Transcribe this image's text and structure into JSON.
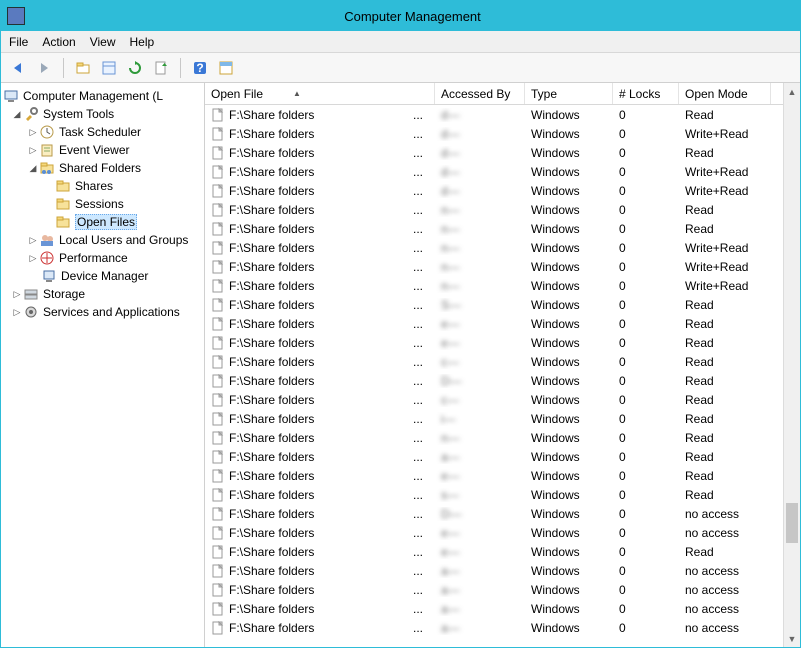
{
  "window": {
    "title": "Computer Management"
  },
  "menu": {
    "file": "File",
    "action": "Action",
    "view": "View",
    "help": "Help"
  },
  "tree": {
    "root": "Computer Management (L",
    "system_tools": "System Tools",
    "task_scheduler": "Task Scheduler",
    "event_viewer": "Event Viewer",
    "shared_folders": "Shared Folders",
    "shares": "Shares",
    "sessions": "Sessions",
    "open_files": "Open Files",
    "local_users": "Local Users and Groups",
    "performance": "Performance",
    "device_manager": "Device Manager",
    "storage": "Storage",
    "services_apps": "Services and Applications"
  },
  "columns": {
    "open_file": "Open File",
    "accessed_by": "Accessed By",
    "type": "Type",
    "locks": "# Locks",
    "open_mode": "Open Mode"
  },
  "rows": [
    {
      "file": "F:\\Share folders",
      "acc": "d—",
      "type": "Windows",
      "locks": "0",
      "mode": "Read"
    },
    {
      "file": "F:\\Share folders",
      "acc": "d—",
      "type": "Windows",
      "locks": "0",
      "mode": "Write+Read"
    },
    {
      "file": "F:\\Share folders",
      "acc": "d—",
      "type": "Windows",
      "locks": "0",
      "mode": "Read"
    },
    {
      "file": "F:\\Share folders",
      "acc": "d—",
      "type": "Windows",
      "locks": "0",
      "mode": "Write+Read"
    },
    {
      "file": "F:\\Share folders",
      "acc": "d—",
      "type": "Windows",
      "locks": "0",
      "mode": "Write+Read"
    },
    {
      "file": "F:\\Share folders",
      "acc": "n—",
      "type": "Windows",
      "locks": "0",
      "mode": "Read"
    },
    {
      "file": "F:\\Share folders",
      "acc": "n—",
      "type": "Windows",
      "locks": "0",
      "mode": "Read"
    },
    {
      "file": "F:\\Share folders",
      "acc": "n—",
      "type": "Windows",
      "locks": "0",
      "mode": "Write+Read"
    },
    {
      "file": "F:\\Share folders",
      "acc": "n—",
      "type": "Windows",
      "locks": "0",
      "mode": "Write+Read"
    },
    {
      "file": "F:\\Share folders",
      "acc": "n—",
      "type": "Windows",
      "locks": "0",
      "mode": "Write+Read"
    },
    {
      "file": "F:\\Share folders",
      "acc": "S—",
      "type": "Windows",
      "locks": "0",
      "mode": "Read"
    },
    {
      "file": "F:\\Share folders",
      "acc": "e—",
      "type": "Windows",
      "locks": "0",
      "mode": "Read"
    },
    {
      "file": "F:\\Share folders",
      "acc": "e—",
      "type": "Windows",
      "locks": "0",
      "mode": "Read"
    },
    {
      "file": "F:\\Share folders",
      "acc": "c—",
      "type": "Windows",
      "locks": "0",
      "mode": "Read"
    },
    {
      "file": "F:\\Share folders",
      "acc": "D—",
      "type": "Windows",
      "locks": "0",
      "mode": "Read"
    },
    {
      "file": "F:\\Share folders",
      "acc": "c—",
      "type": "Windows",
      "locks": "0",
      "mode": "Read"
    },
    {
      "file": "F:\\Share folders",
      "acc": "i—",
      "type": "Windows",
      "locks": "0",
      "mode": "Read"
    },
    {
      "file": "F:\\Share folders",
      "acc": "n—",
      "type": "Windows",
      "locks": "0",
      "mode": "Read"
    },
    {
      "file": "F:\\Share folders",
      "acc": "a—",
      "type": "Windows",
      "locks": "0",
      "mode": "Read"
    },
    {
      "file": "F:\\Share folders",
      "acc": "e—",
      "type": "Windows",
      "locks": "0",
      "mode": "Read"
    },
    {
      "file": "F:\\Share folders",
      "acc": "s—",
      "type": "Windows",
      "locks": "0",
      "mode": "Read"
    },
    {
      "file": "F:\\Share folders",
      "acc": "D—",
      "type": "Windows",
      "locks": "0",
      "mode": "no access"
    },
    {
      "file": "F:\\Share folders",
      "acc": "e—",
      "type": "Windows",
      "locks": "0",
      "mode": "no access"
    },
    {
      "file": "F:\\Share folders",
      "acc": "e—",
      "type": "Windows",
      "locks": "0",
      "mode": "Read"
    },
    {
      "file": "F:\\Share folders",
      "acc": "a—",
      "type": "Windows",
      "locks": "0",
      "mode": "no access"
    },
    {
      "file": "F:\\Share folders",
      "acc": "a—",
      "type": "Windows",
      "locks": "0",
      "mode": "no access"
    },
    {
      "file": "F:\\Share folders",
      "acc": "a—",
      "type": "Windows",
      "locks": "0",
      "mode": "no access"
    },
    {
      "file": "F:\\Share folders",
      "acc": "a—",
      "type": "Windows",
      "locks": "0",
      "mode": "no access"
    }
  ]
}
